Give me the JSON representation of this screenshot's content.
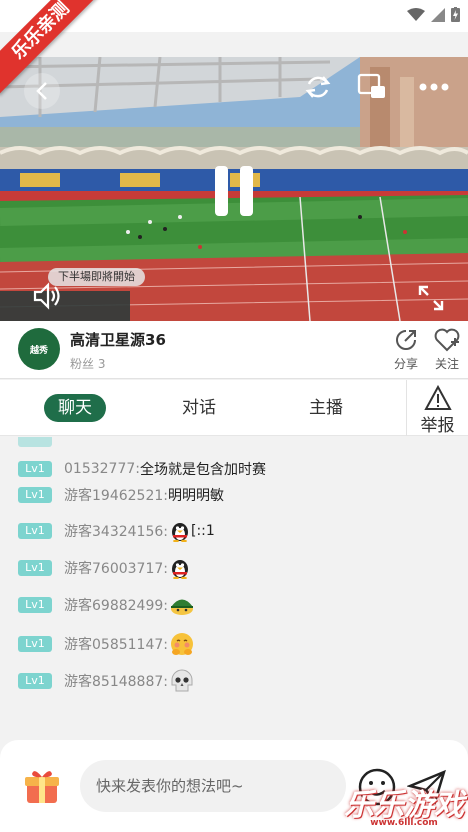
{
  "watermark_top": "乐乐亲测",
  "video": {
    "overlay_label": "下半場即將開始"
  },
  "channel": {
    "avatar_text": "越秀",
    "title": "高清卫星源36",
    "fans_label": "粉丝 3",
    "share_label": "分享",
    "follow_label": "关注"
  },
  "tabs": [
    {
      "label": "聊天",
      "active": true
    },
    {
      "label": "对话",
      "active": false
    },
    {
      "label": "主播",
      "active": false
    }
  ],
  "report_label": "举报",
  "messages": [
    {
      "level": "Lv1",
      "nick": "01532777:",
      "text": "全场就是包含加时赛",
      "emoji": ""
    },
    {
      "level": "Lv1",
      "nick": "游客19462521:",
      "text": "明明明敏",
      "emoji": ""
    },
    {
      "level": "Lv1",
      "nick": "游客34324156:",
      "text": "[::1",
      "emoji": "penguin"
    },
    {
      "level": "Lv1",
      "nick": "游客76003717:",
      "text": "",
      "emoji": "penguin"
    },
    {
      "level": "Lv1",
      "nick": "游客69882499:",
      "text": "",
      "emoji": "helmet"
    },
    {
      "level": "Lv1",
      "nick": "游客05851147:",
      "text": "",
      "emoji": "shy"
    },
    {
      "level": "Lv1",
      "nick": "游客85148887:",
      "text": "",
      "emoji": "skull"
    }
  ],
  "input": {
    "placeholder": "快来发表你的想法吧~"
  },
  "bottom_watermark": {
    "main": "乐乐游戏",
    "sub": "www.6lll.com"
  },
  "colors": {
    "accent": "#1f6e4a",
    "level_badge": "#7dd4cf",
    "ribbon": "#e0332d"
  }
}
